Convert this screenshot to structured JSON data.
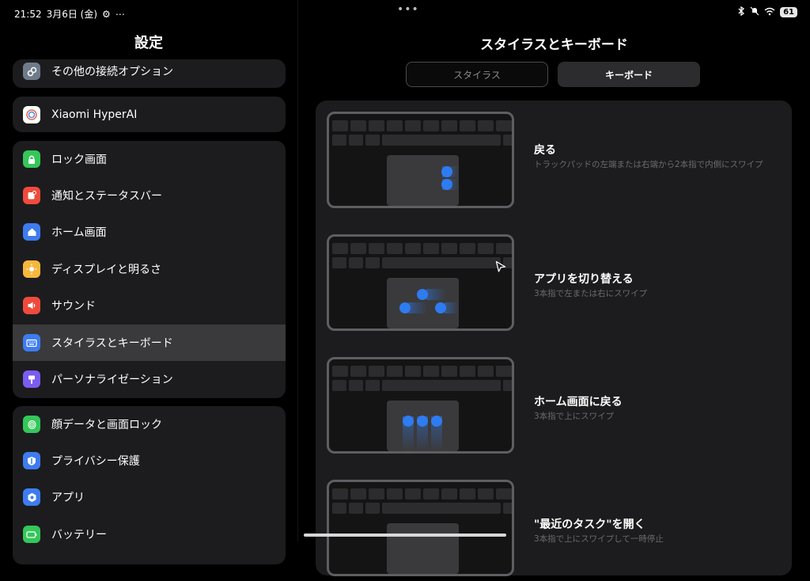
{
  "status_bar": {
    "time": "21:52",
    "date": "3月6日 (金)",
    "more": "⋯",
    "battery": "61"
  },
  "top_dots": "•••",
  "left": {
    "title": "設定",
    "groups": [
      {
        "items": [
          {
            "label": "その他の接続オプション",
            "icon": "link-icon",
            "color": "#6f7b8a"
          }
        ]
      },
      {
        "items": [
          {
            "label": "Xiaomi HyperAI",
            "icon": "hyperai-icon",
            "color": "#ffffff"
          }
        ]
      },
      {
        "items": [
          {
            "label": "ロック画面",
            "icon": "lock-icon",
            "color": "#34c759"
          },
          {
            "label": "通知とステータスバー",
            "icon": "notification-icon",
            "color": "#ef4b3c"
          },
          {
            "label": "ホーム画面",
            "icon": "home-icon",
            "color": "#3d7cf0"
          },
          {
            "label": "ディスプレイと明るさ",
            "icon": "sun-icon",
            "color": "#f5b83d"
          },
          {
            "label": "サウンド",
            "icon": "speaker-icon",
            "color": "#ef4b3c"
          },
          {
            "label": "スタイラスとキーボード",
            "icon": "keyboard-icon",
            "color": "#3d7cf0",
            "selected": true
          },
          {
            "label": "パーソナライゼーション",
            "icon": "brush-icon",
            "color": "#7b5cf0"
          }
        ]
      },
      {
        "items": [
          {
            "label": "顔データと画面ロック",
            "icon": "fingerprint-icon",
            "color": "#34c759"
          },
          {
            "label": "プライバシー保護",
            "icon": "shield-icon",
            "color": "#3d7cf0"
          },
          {
            "label": "アプリ",
            "icon": "gear-icon",
            "color": "#3d7cf0"
          },
          {
            "label": "バッテリー",
            "icon": "battery-icon",
            "color": "#34c759"
          }
        ]
      }
    ]
  },
  "right": {
    "title": "スタイラスとキーボード",
    "tabs": [
      {
        "label": "スタイラス",
        "active": false
      },
      {
        "label": "キーボード",
        "active": true
      }
    ],
    "gestures": [
      {
        "title": "戻る",
        "desc": "トラックパッドの左端または右端から2本指で内側にスワイプ"
      },
      {
        "title": "アプリを切り替える",
        "desc": "3本指で左または右にスワイプ"
      },
      {
        "title": "ホーム画面に戻る",
        "desc": "3本指で上にスワイプ"
      },
      {
        "title": "\"最近のタスク\"を開く",
        "desc": "3本指で上にスワイプして一時停止"
      }
    ]
  },
  "colors": {
    "accent": "#2f7bf0",
    "background": "#000000",
    "card": "#1c1c1e",
    "selected": "#3a3a3c"
  }
}
